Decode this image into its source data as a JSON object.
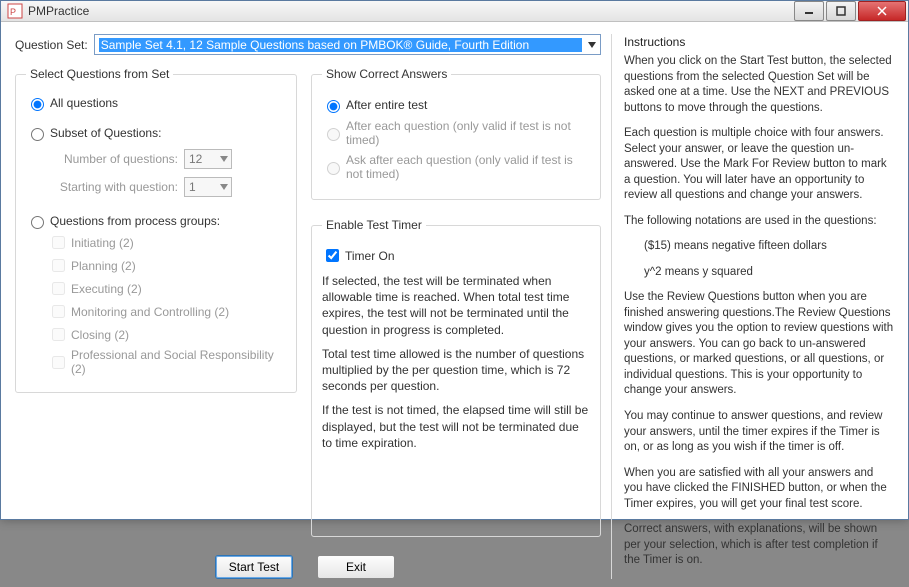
{
  "window": {
    "title": "PMPractice"
  },
  "qset": {
    "label": "Question Set:",
    "selected": "Sample Set 4.1,  12 Sample Questions based on PMBOK® Guide, Fourth Edition"
  },
  "select_fs": {
    "legend": "Select Questions from Set",
    "r_all": "All questions",
    "r_subset": "Subset of Questions:",
    "num_label": "Number of questions:",
    "num_value": "12",
    "start_label": "Starting with question:",
    "start_value": "1",
    "r_groups": "Questions from process groups:",
    "groups": {
      "g0": "Initiating  (2)",
      "g1": "Planning  (2)",
      "g2": "Executing  (2)",
      "g3": "Monitoring and Controlling  (2)",
      "g4": "Closing  (2)",
      "g5": "Professional and Social Responsibility  (2)"
    }
  },
  "sca": {
    "legend": "Show Correct Answers",
    "r_after_test": "After entire test",
    "r_after_each": "After each question  (only valid if test is not timed)",
    "r_ask_each": "Ask after each question (only valid if test is not timed)"
  },
  "timer": {
    "legend": "Enable Test Timer",
    "cb": "Timer On",
    "p1": "If selected, the test will be terminated when allowable time is reached. When total test time expires, the test will not be terminated until the question in progress is completed.",
    "p2": "Total test time allowed is the number of questions multiplied by the per question time, which is 72 seconds per question.",
    "p3": "If the test is not timed, the elapsed time will still be displayed, but the test will not be terminated due to time expiration."
  },
  "buttons": {
    "start": "Start Test",
    "exit": "Exit"
  },
  "instr": {
    "hdr": "Instructions",
    "p1": "When you click on the Start Test button, the selected questions from the selected Question Set will be asked one at a time. Use the NEXT and PREVIOUS buttons to move through the questions.",
    "p2": "Each question is multiple choice with four answers. Select your answer, or leave the question un-answered. Use the Mark For Review button to mark a question. You will later have an opportunity to review all questions and change your answers.",
    "p3": "The following notations are used in the questions:",
    "p4": "($15) means negative fifteen dollars",
    "p5": "y^2 means y squared",
    "p6": "Use the Review Questions button when you are finished answering questions.The Review Questions window gives you the option to review questions with your answers. You can go back to un-answered questions, or marked questions, or all questions, or individual questions. This is your opportunity to change your answers.",
    "p7": "You may continue to answer questions, and review your answers, until the timer expires if the Timer is on, or as long as you wish if the timer is off.",
    "p8": "When you are satisfied with all your answers and you have clicked the FINISHED button, or when the Timer expires, you will get your final test score.",
    "p9": "Correct answers, with explanations, will be shown per your selection, which is after test completion if the Timer is on."
  }
}
